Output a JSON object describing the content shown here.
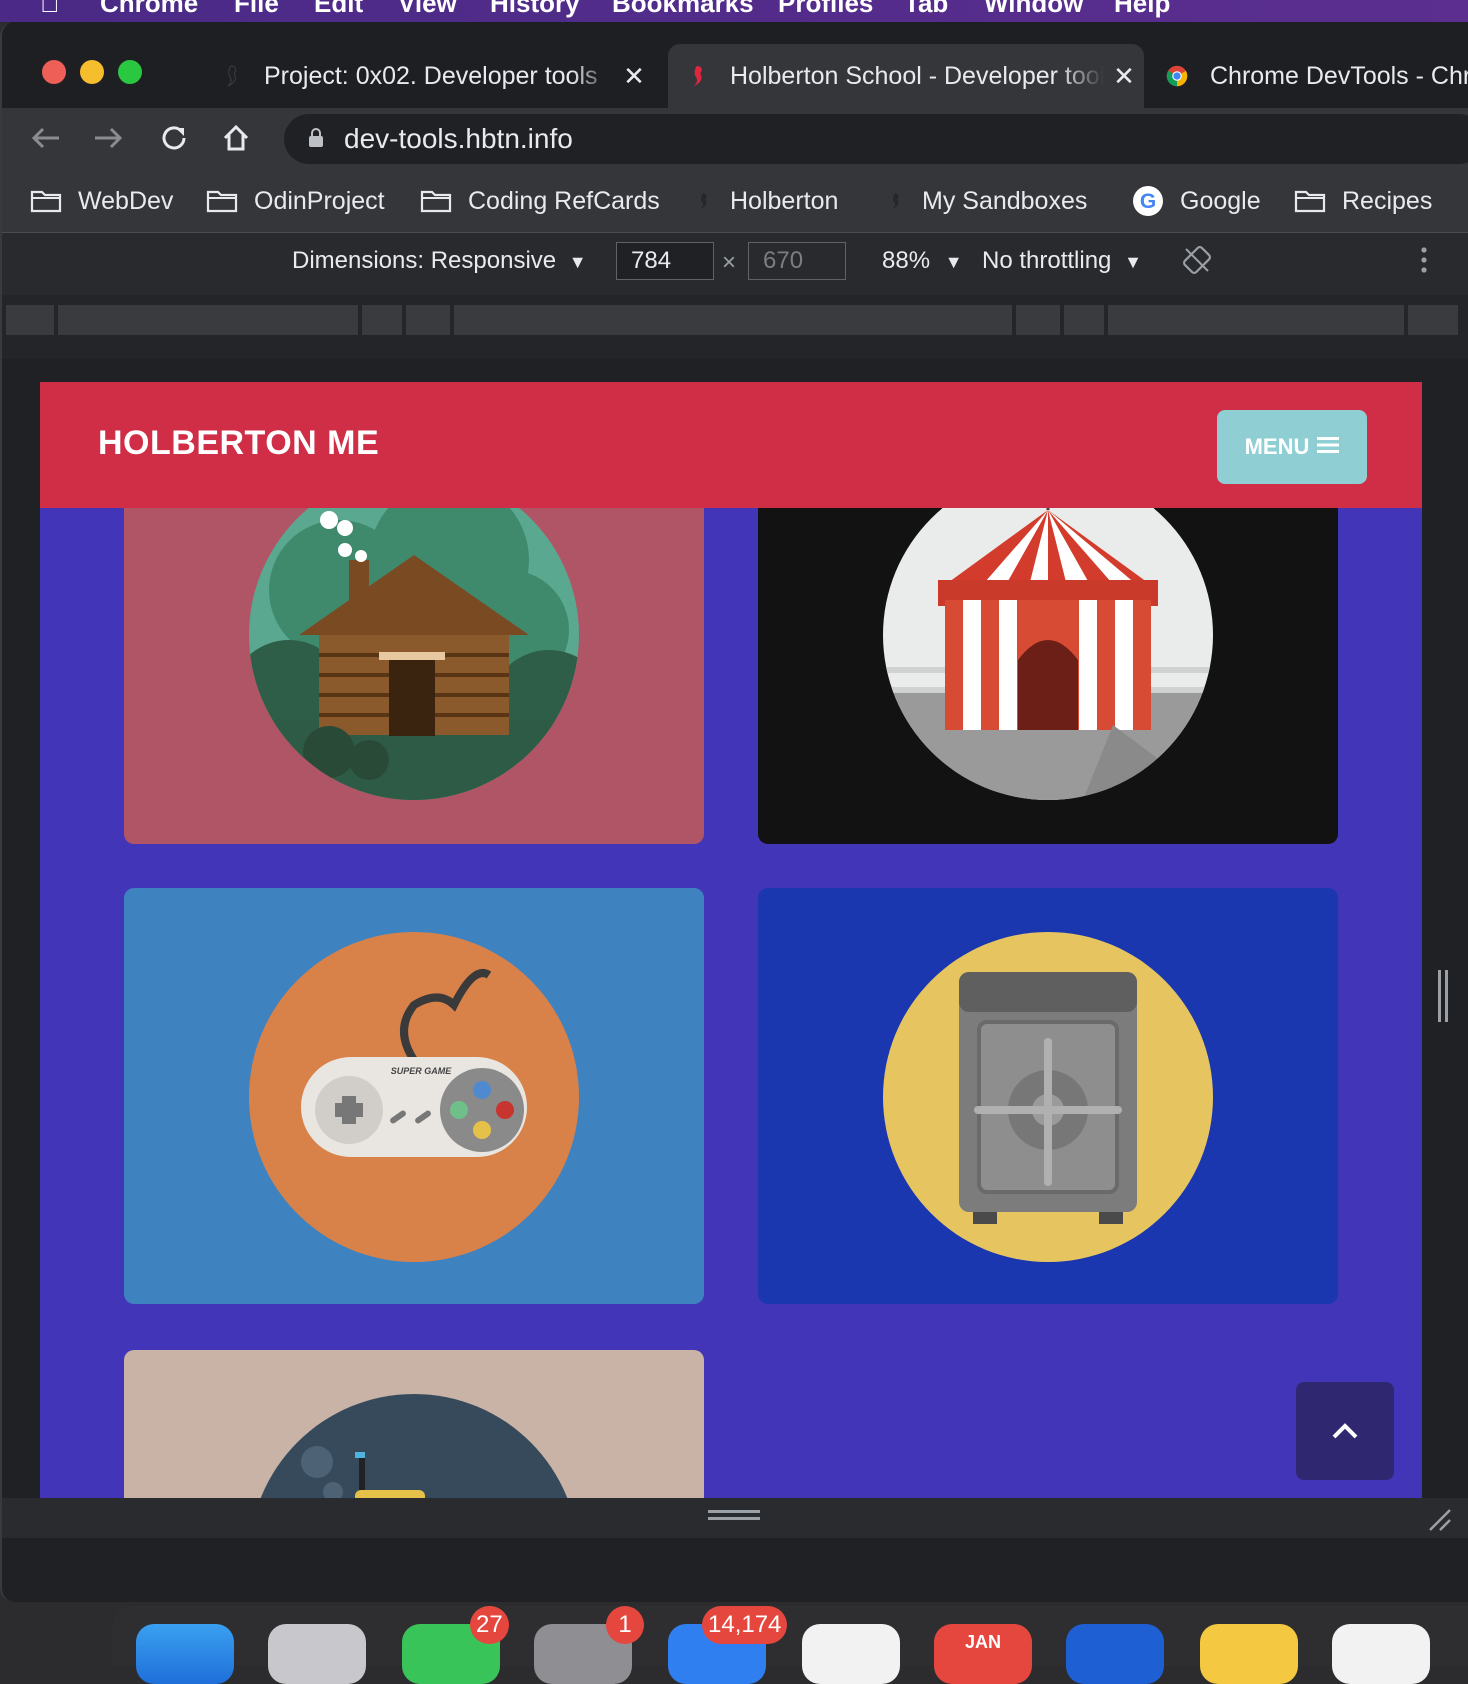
{
  "menubar": {
    "items": [
      "Chrome",
      "File",
      "Edit",
      "View",
      "History",
      "Bookmarks",
      "Profiles",
      "Tab",
      "Window",
      "Help"
    ]
  },
  "tabs": [
    {
      "title": "Project: 0x02. Developer tools",
      "icon": "seahorse-icon",
      "active": false
    },
    {
      "title": "Holberton School - Developer tools",
      "icon": "seahorse-icon",
      "active": true
    },
    {
      "title": "Chrome DevTools - Chrome Developers",
      "icon": "chrome-icon",
      "active": false
    }
  ],
  "address_bar": {
    "url": "dev-tools.hbtn.info"
  },
  "bookmarks": [
    {
      "label": "WebDev",
      "icon": "folder-icon"
    },
    {
      "label": "OdinProject",
      "icon": "folder-icon"
    },
    {
      "label": "Coding RefCards",
      "icon": "folder-icon"
    },
    {
      "label": "Holberton",
      "icon": "seahorse-icon"
    },
    {
      "label": "My Sandboxes",
      "icon": "seahorse-icon"
    },
    {
      "label": "Google",
      "icon": "google-icon"
    },
    {
      "label": "Recipes",
      "icon": "folder-icon"
    }
  ],
  "device_toolbar": {
    "dimensions_label": "Dimensions: Responsive",
    "width": "784",
    "height": "670",
    "times": "×",
    "zoom": "88%",
    "throttling": "No throttling"
  },
  "site": {
    "brand": "HOLBERTON ME",
    "menu_label": "MENU",
    "cards": [
      {
        "name": "log-cabin",
        "bg": "#b05566",
        "circle": "#5aa890"
      },
      {
        "name": "circus-tent",
        "bg": "#121212",
        "circle": "#e9eceb"
      },
      {
        "name": "game-controller",
        "bg": "#3f82c0",
        "circle": "#d8824a",
        "caption": "SUPER GAME"
      },
      {
        "name": "safe",
        "bg": "#1a37b0",
        "circle": "#e6c560"
      },
      {
        "name": "submarine",
        "bg": "#c8b3a6",
        "circle": "#364a5c"
      }
    ]
  },
  "dock": {
    "badges": {
      "messages": "27",
      "settings": "1",
      "mail": "14,174",
      "calendar_month": "JAN"
    }
  },
  "colors": {
    "header_red": "#d02d47",
    "page_purple": "#4235b8",
    "menu_teal": "#8fcfd3",
    "scroll_btn": "#2f2870"
  }
}
